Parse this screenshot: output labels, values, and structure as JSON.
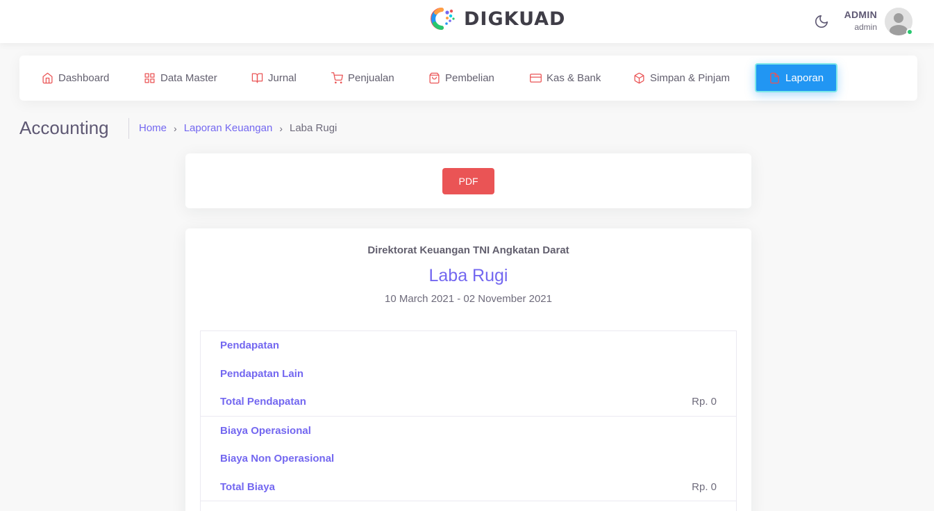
{
  "header": {
    "brand_name": "DIGKUAD",
    "user_name": "ADMIN",
    "user_role": "admin",
    "status_color": "#28c76f"
  },
  "nav": {
    "items": [
      {
        "label": "Dashboard",
        "icon": "home-icon"
      },
      {
        "label": "Data Master",
        "icon": "grid-icon"
      },
      {
        "label": "Jurnal",
        "icon": "book-open-icon"
      },
      {
        "label": "Penjualan",
        "icon": "shopping-cart-icon"
      },
      {
        "label": "Pembelian",
        "icon": "shopping-bag-icon"
      },
      {
        "label": "Kas & Bank",
        "icon": "credit-card-icon"
      },
      {
        "label": "Simpan & Pinjam",
        "icon": "box-icon"
      },
      {
        "label": "Laporan",
        "icon": "file-icon",
        "active": true
      }
    ],
    "active_color": "#2196f3"
  },
  "page": {
    "title": "Accounting",
    "breadcrumb": [
      "Home",
      "Laporan Keuangan",
      "Laba Rugi"
    ]
  },
  "actions": {
    "pdf_label": "PDF",
    "pdf_color": "#ea5455"
  },
  "report": {
    "organization": "Direktorat Keuangan TNI Angkatan Darat",
    "title": "Laba Rugi",
    "period": "10 March 2021 - 02 November 2021",
    "rows": [
      {
        "label": "Pendapatan",
        "value": ""
      },
      {
        "label": "Pendapatan Lain",
        "value": ""
      },
      {
        "label": "Total Pendapatan",
        "value": "Rp. 0"
      },
      {
        "label": "Biaya Operasional",
        "value": ""
      },
      {
        "label": "Biaya Non Operasional",
        "value": ""
      },
      {
        "label": "Total Biaya",
        "value": "Rp. 0"
      }
    ],
    "accent_color": "#7367f0"
  }
}
